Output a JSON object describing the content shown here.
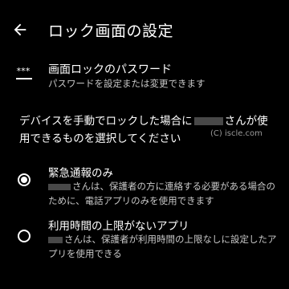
{
  "header": {
    "title": "ロック画面の設定"
  },
  "password": {
    "title": "画面ロックのパスワード",
    "subtitle": "パスワードを設定または変更できます",
    "icon_stars": "***"
  },
  "description": {
    "part1": "デバイスを手動でロックした場合に",
    "part2": "さんが使用できるものを選択してください"
  },
  "watermark": "(C) iscle.com",
  "options": [
    {
      "label": "緊急通報のみ",
      "selected": true,
      "description": "さんは、保護者の方に連絡する必要がある場合のために、電話アプリのみを使用できます"
    },
    {
      "label": "利用時間の上限がないアプリ",
      "selected": false,
      "description": "さんは、保護者が利用時間の上限なしに設定したアプリを使用できる"
    }
  ]
}
